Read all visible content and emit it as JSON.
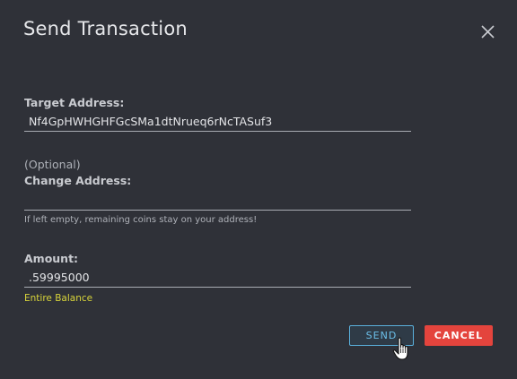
{
  "dialog": {
    "title": "Send Transaction",
    "close_icon": "close-icon"
  },
  "target_address": {
    "label": "Target Address:",
    "value": "Nf4GpHWHGHFGcSMa1dtNrueq6rNcTASuf3"
  },
  "change_address": {
    "optional_text": "(Optional)",
    "label": "Change Address:",
    "value": "",
    "hint": "If left empty, remaining coins stay on your address!"
  },
  "amount": {
    "label": "Amount:",
    "value": ".59995000",
    "entire_balance_link": "Entire Balance"
  },
  "buttons": {
    "send": "SEND",
    "cancel": "CANCEL"
  },
  "colors": {
    "background": "#2f3138",
    "send_accent": "#5ab0dc",
    "cancel_red": "#e4443d",
    "link_yellow": "#d8d43a"
  }
}
